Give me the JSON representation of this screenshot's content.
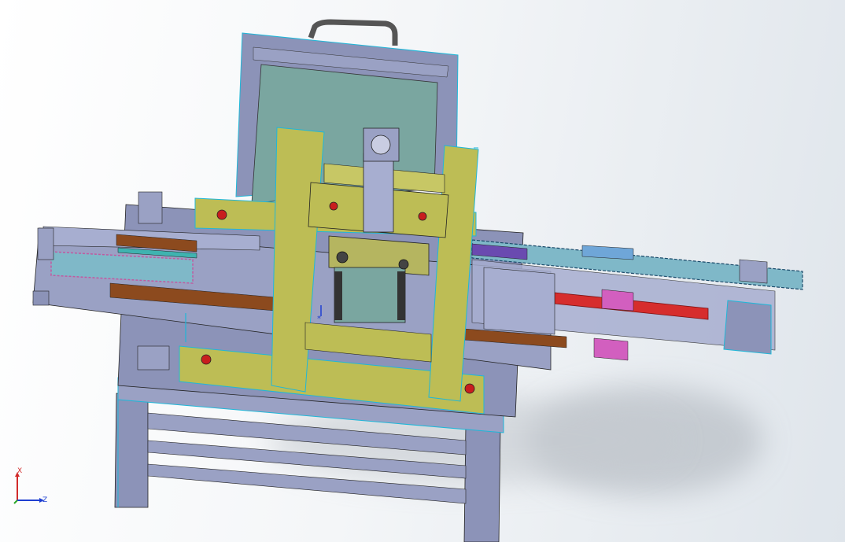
{
  "viewport": {
    "background_top": "#ffffff",
    "background_bottom": "#dfe5eb"
  },
  "model": {
    "edge_color": "#1fb7d8",
    "frame_color": "#8c93b8",
    "yellow_color": "#bdbd55",
    "teal_panel_color": "#7aa6a0",
    "red_rod_color": "#d62d2d",
    "magenta_color": "#d25fbf",
    "brown_rail_color": "#8c4a1e",
    "chain_color": "#7fb8c8"
  },
  "triad": {
    "x_label": "X",
    "z_label": "Z",
    "x_color": "#d12b2b",
    "y_color": "#2ba82b",
    "z_color": "#1f3fd1"
  }
}
